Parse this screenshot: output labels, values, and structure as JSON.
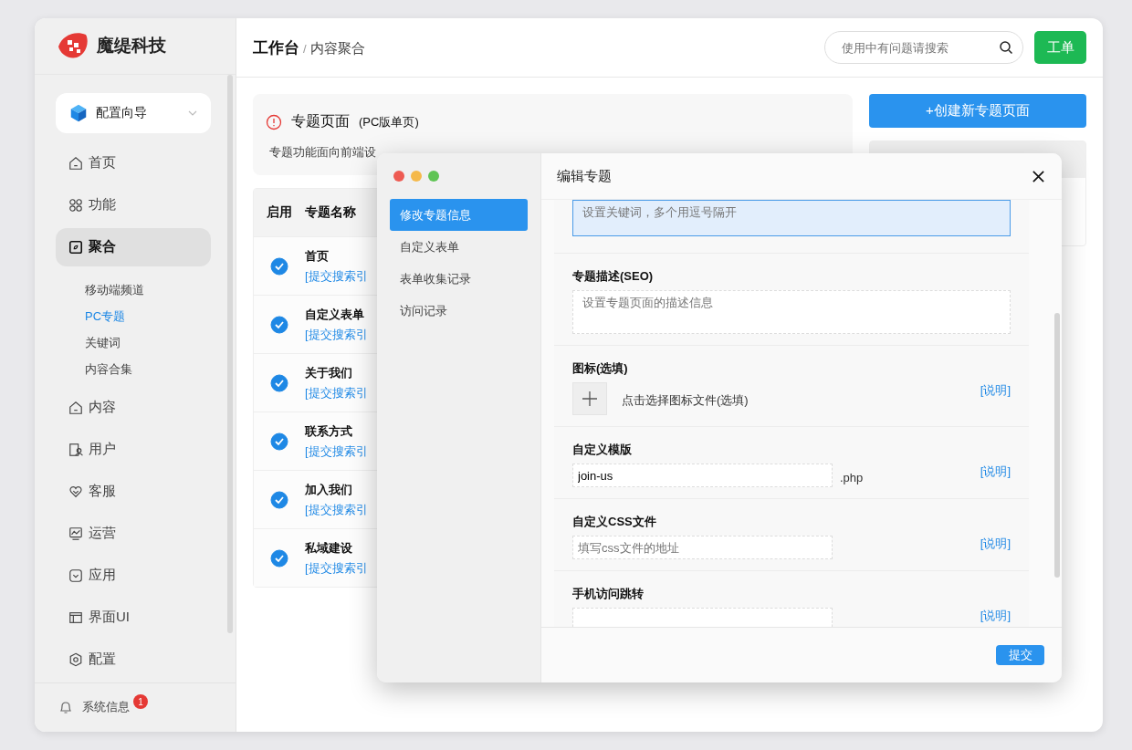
{
  "brand": {
    "name": "魔缇科技"
  },
  "wizard": {
    "label": "配置向导"
  },
  "nav": [
    {
      "label": "首页",
      "selected": false
    },
    {
      "label": "功能",
      "selected": false
    },
    {
      "label": "聚合",
      "selected": true,
      "children": [
        {
          "label": "移动端频道",
          "selected": false
        },
        {
          "label": "PC专题",
          "selected": true
        },
        {
          "label": "关键词",
          "selected": false
        },
        {
          "label": "内容合集",
          "selected": false
        }
      ]
    },
    {
      "label": "内容",
      "selected": false
    },
    {
      "label": "用户",
      "selected": false
    },
    {
      "label": "客服",
      "selected": false
    },
    {
      "label": "运营",
      "selected": false
    },
    {
      "label": "应用",
      "selected": false
    },
    {
      "label": "界面UI",
      "selected": false
    },
    {
      "label": "配置",
      "selected": false
    }
  ],
  "notifications": {
    "label": "系统信息",
    "count": "1"
  },
  "breadcrumb": {
    "items": [
      "工作台",
      "内容聚合"
    ],
    "separator": "/"
  },
  "search": {
    "placeholder": "使用中有问题请搜索"
  },
  "ticket_button": "工单",
  "notice": {
    "title": "专题页面",
    "subtitle": "(PC版单页)",
    "bullet": "专题功能面向前端设"
  },
  "create_button": "+创建新专题页面",
  "table": {
    "columns": [
      "启用",
      "专题名称"
    ],
    "rows": [
      {
        "enabled": true,
        "name": "首页",
        "link": "[提交搜索引"
      },
      {
        "enabled": true,
        "name": "自定义表单",
        "link": "[提交搜索引"
      },
      {
        "enabled": true,
        "name": "关于我们",
        "link": "[提交搜索引"
      },
      {
        "enabled": true,
        "name": "联系方式",
        "link": "[提交搜索引"
      },
      {
        "enabled": true,
        "name": "加入我们",
        "link": "[提交搜索引"
      },
      {
        "enabled": true,
        "name": "私域建设",
        "link": "[提交搜索引"
      }
    ]
  },
  "dialog": {
    "title": "编辑专题",
    "tabs": [
      {
        "label": "修改专题信息",
        "selected": true
      },
      {
        "label": "自定义表单",
        "selected": false
      },
      {
        "label": "表单收集记录",
        "selected": false
      },
      {
        "label": "访问记录",
        "selected": false
      }
    ],
    "fields": [
      {
        "kind": "textarea",
        "focused": true,
        "placeholder": "设置关键词，多个用逗号隔开"
      },
      {
        "kind": "textarea",
        "focused": false,
        "label": "专题描述(SEO)",
        "placeholder": "设置专题页面的描述信息"
      },
      {
        "kind": "upload",
        "label": "图标(选填)",
        "text": "点击选择图标文件(选填)",
        "help": "[说明]"
      },
      {
        "kind": "input",
        "label": "自定义模版",
        "value": "join-us",
        "suffix": ".php",
        "help": "[说明]"
      },
      {
        "kind": "input",
        "label": "自定义CSS文件",
        "placeholder": "填写css文件的地址",
        "help": "[说明]"
      },
      {
        "kind": "input",
        "label": "手机访问跳转",
        "help": "[说明]"
      }
    ],
    "submit": "提交"
  }
}
